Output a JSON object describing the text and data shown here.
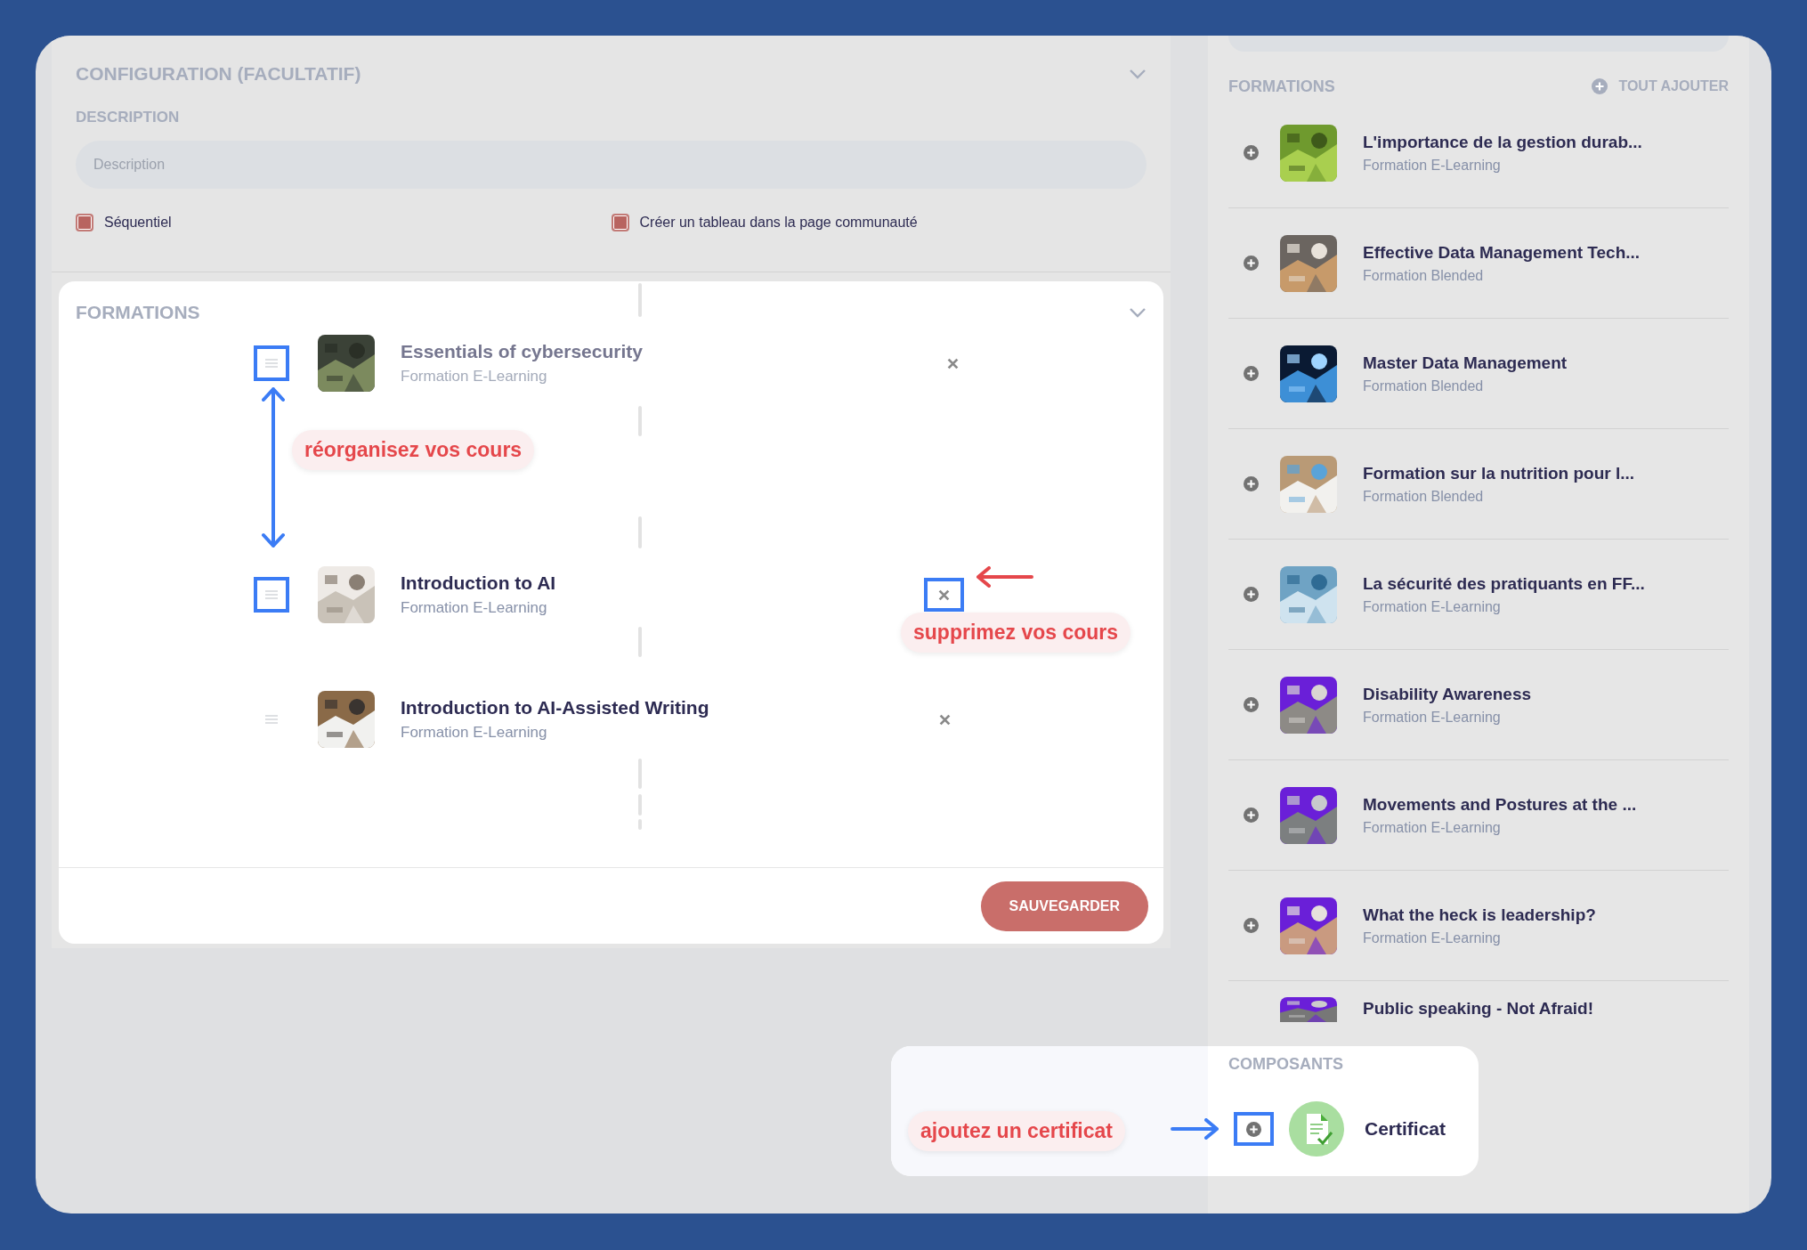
{
  "config": {
    "title": "CONFIGURATION (FACULTATIF)",
    "description": {
      "label": "DESCRIPTION",
      "placeholder": "Description"
    },
    "options": [
      {
        "label": "Séquentiel",
        "checked": true
      },
      {
        "label": "Créer un tableau dans la page communauté",
        "checked": true
      }
    ]
  },
  "formations_panel": {
    "title": "FORMATIONS",
    "courses": [
      {
        "title": "Essentials of cybersecurity",
        "type": "Formation E-Learning",
        "dimmed": true,
        "handle_highlighted": true,
        "remove_highlighted": false
      },
      {
        "title": "Introduction to AI",
        "type": "Formation E-Learning",
        "dimmed": false,
        "handle_highlighted": true,
        "remove_highlighted": true
      },
      {
        "title": "Introduction to AI-Assisted Writing",
        "type": "Formation E-Learning",
        "dimmed": false,
        "handle_highlighted": false,
        "remove_highlighted": false
      }
    ],
    "save_button": "SAUVEGARDER"
  },
  "catalog": {
    "title": "FORMATIONS",
    "add_all": "TOUT AJOUTER",
    "items": [
      {
        "title": "L'importance de la gestion durab...",
        "type": "Formation E-Learning"
      },
      {
        "title": "Effective Data Management Tech...",
        "type": "Formation Blended"
      },
      {
        "title": "Master Data Management",
        "type": "Formation Blended"
      },
      {
        "title": "Formation sur la nutrition pour l...",
        "type": "Formation Blended"
      },
      {
        "title": "La sécurité des pratiquants en FF...",
        "type": "Formation E-Learning"
      },
      {
        "title": "Disability Awareness",
        "type": "Formation E-Learning"
      },
      {
        "title": "Movements and Postures at the ...",
        "type": "Formation E-Learning"
      },
      {
        "title": "What the heck is leadership?",
        "type": "Formation E-Learning"
      },
      {
        "title": "Public speaking - Not Afraid!"
      }
    ],
    "components": {
      "title": "COMPOSANTS",
      "items": [
        {
          "label": "Certificat",
          "add_highlighted": true
        }
      ]
    }
  },
  "annotations": [
    {
      "kind": "reorder",
      "text": "réorganisez vos cours"
    },
    {
      "kind": "remove",
      "text": "supprimez vos cours"
    },
    {
      "kind": "add",
      "text": "ajoutez un certificat"
    }
  ]
}
